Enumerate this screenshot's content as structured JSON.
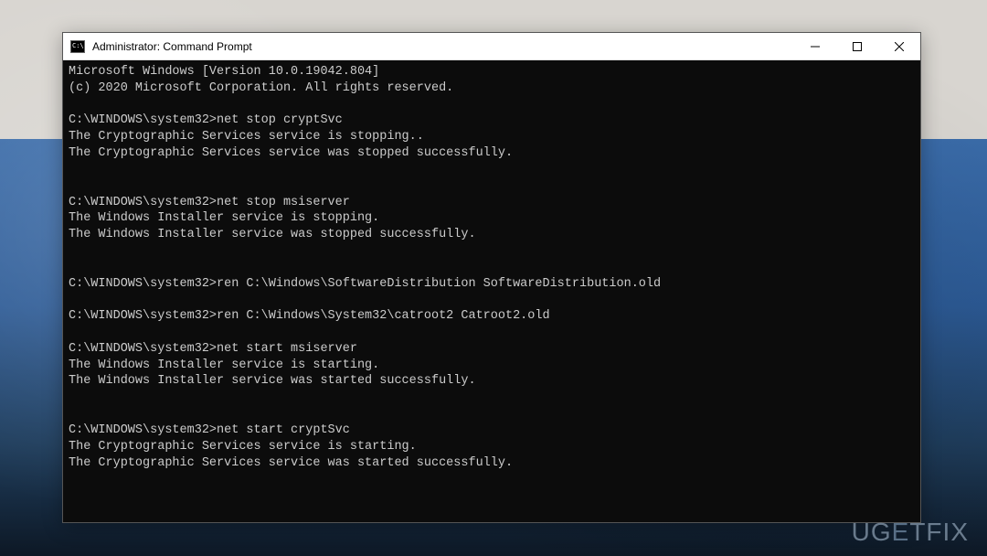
{
  "window": {
    "title": "Administrator: Command Prompt"
  },
  "terminal": {
    "prompt": "C:\\WINDOWS\\system32>",
    "header": [
      "Microsoft Windows [Version 10.0.19042.804]",
      "(c) 2020 Microsoft Corporation. All rights reserved."
    ],
    "blocks": [
      {
        "cmd": "net stop cryptSvc",
        "output": [
          "The Cryptographic Services service is stopping..",
          "The Cryptographic Services service was stopped successfully."
        ]
      },
      {
        "cmd": "net stop msiserver",
        "output": [
          "The Windows Installer service is stopping.",
          "The Windows Installer service was stopped successfully."
        ]
      },
      {
        "cmd": "ren C:\\Windows\\SoftwareDistribution SoftwareDistribution.old",
        "output": []
      },
      {
        "cmd": "ren C:\\Windows\\System32\\catroot2 Catroot2.old",
        "output": []
      },
      {
        "cmd": "net start msiserver",
        "output": [
          "The Windows Installer service is starting.",
          "The Windows Installer service was started successfully."
        ]
      },
      {
        "cmd": "net start cryptSvc",
        "output": [
          "The Cryptographic Services service is starting.",
          "The Cryptographic Services service was started successfully."
        ]
      }
    ]
  },
  "watermark": {
    "prefix": "UG",
    "accent": "E",
    "suffix": "TFIX"
  }
}
